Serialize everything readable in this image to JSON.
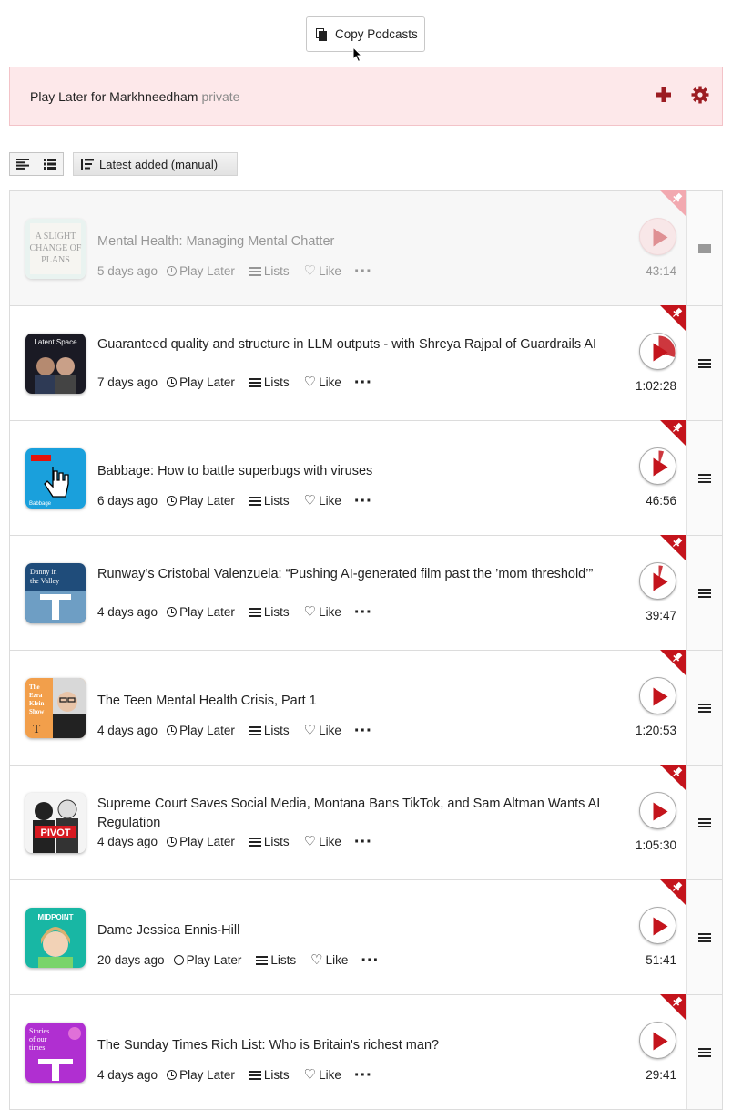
{
  "toolbar_top": {
    "copy_label": "Copy Podcasts"
  },
  "banner": {
    "owner": "Play Later for Markhneedham",
    "visibility": "private"
  },
  "sort": {
    "label": "Latest added (manual)"
  },
  "meta_labels": {
    "play_later": "Play Later",
    "lists": "Lists",
    "like": "Like"
  },
  "colors": {
    "accent": "#c4141c",
    "banner_bg": "#fde8ea",
    "banner_icon": "#9c1c22"
  },
  "episodes": [
    {
      "title": "Mental Health: Managing Mental Chatter",
      "age": "5 days ago",
      "duration": "43:14",
      "progress": 0,
      "faded": true,
      "art": "a-slight-change-of-plans"
    },
    {
      "title": "Guaranteed quality and structure in LLM outputs - with Shreya Rajpal of Guardrails AI",
      "age": "7 days ago",
      "duration": "1:02:28",
      "progress": 0.3,
      "art": "latent-space"
    },
    {
      "title": "Babbage: How to battle superbugs with viruses",
      "age": "6 days ago",
      "duration": "46:56",
      "progress": 0.05,
      "art": "babbage"
    },
    {
      "title": "Runway’s Cristobal Valenzuela: “Pushing AI-generated film past the ’mom threshold’”",
      "age": "4 days ago",
      "duration": "39:47",
      "progress": 0.04,
      "art": "danny-in-the-valley"
    },
    {
      "title": "The Teen Mental Health Crisis, Part 1",
      "age": "4 days ago",
      "duration": "1:20:53",
      "progress": 0,
      "art": "ezra-klein-show"
    },
    {
      "title": "Supreme Court Saves Social Media, Montana Bans TikTok, and Sam Altman Wants AI Regulation",
      "age": "4 days ago",
      "duration": "1:05:30",
      "progress": 0,
      "art": "pivot"
    },
    {
      "title": "Dame Jessica Ennis-Hill",
      "age": "20 days ago",
      "duration": "51:41",
      "progress": 0,
      "art": "the-midpoint"
    },
    {
      "title": "The Sunday Times Rich List: Who is Britain's richest man?",
      "age": "4 days ago",
      "duration": "29:41",
      "progress": 0,
      "art": "stories-of-our-times"
    }
  ],
  "art_text": {
    "a-slight-change-of-plans": "A SLIGHT CHANGE OF PLANS",
    "latent-space": "Latent Space",
    "babbage": "Babbage",
    "danny-in-the-valley": "Danny in the Valley",
    "ezra-klein-show": "The Ezra Klein Show",
    "pivot": "PIVOT",
    "the-midpoint": "THE MIDPOINT",
    "stories-of-our-times": "Stories of our times"
  }
}
